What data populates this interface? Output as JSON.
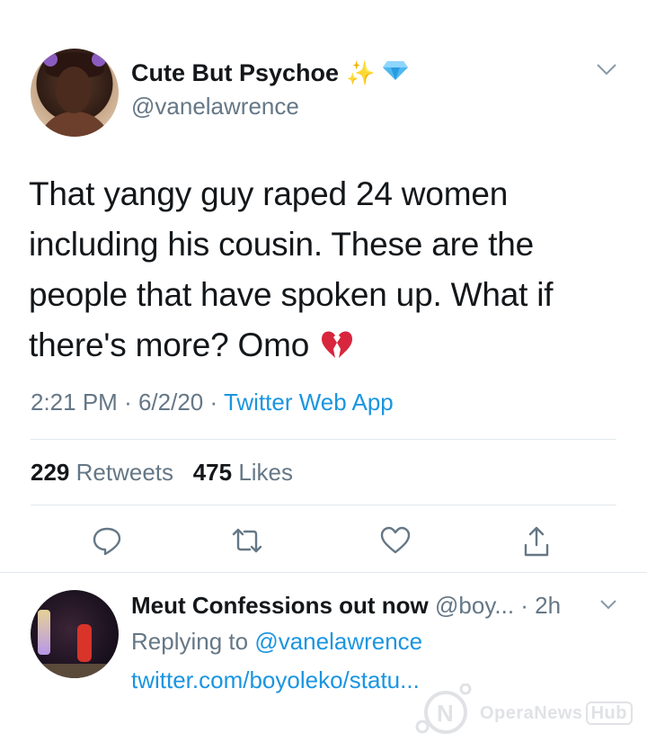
{
  "tweet": {
    "display_name": "Cute But Psychoe",
    "emoji_sparkles": "✨",
    "handle": "@vanelawrence",
    "text": "That yangy guy raped 24 women including his cousin. These are the people that have spoken up. What if there's more? Omo",
    "time": "2:21 PM",
    "date": "6/2/20",
    "sep": "·",
    "client": "Twitter Web App",
    "retweets_count": "229",
    "retweets_label": "Retweets",
    "likes_count": "475",
    "likes_label": "Likes",
    "icons": [
      "broken-heart-emoji",
      "diamond-emoji",
      "chevron-down-icon",
      "reply-icon",
      "retweet-icon",
      "like-icon",
      "share-icon"
    ]
  },
  "reply": {
    "display_name": "Meut Confessions out now",
    "handle": "@boy...",
    "time": "· 2h",
    "replying_prefix": "Replying to",
    "replying_to": "@vanelawrence",
    "link": "twitter.com/boyoleko/statu..."
  },
  "watermark": {
    "brand": "OperaNews",
    "hub": "Hub"
  },
  "colors": {
    "link": "#1b95e0",
    "muted": "#657786",
    "text": "#14171a",
    "divider": "#e1e8ed"
  }
}
